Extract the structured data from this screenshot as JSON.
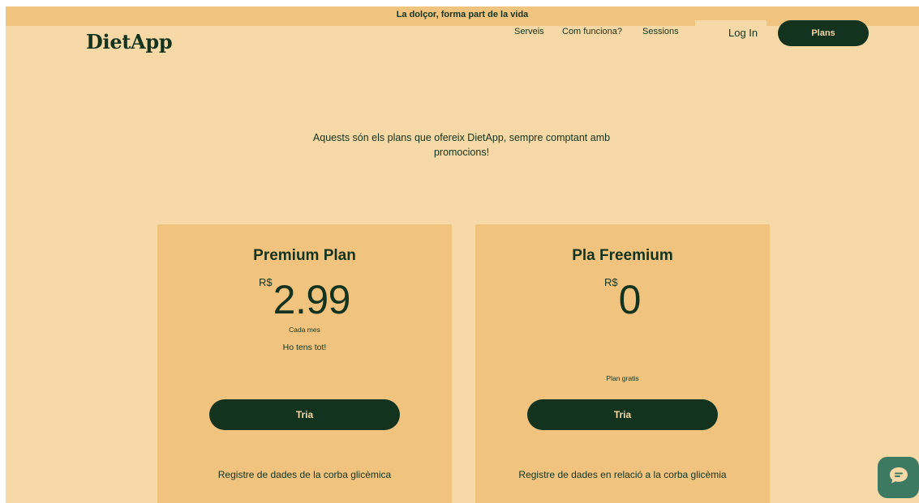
{
  "announcement": "La dolçor, forma part de la vida",
  "brand": "DietApp",
  "nav": {
    "links": [
      "Serveis",
      "Com funciona?",
      "Sessions"
    ],
    "login": "Log In",
    "plans_button": "Plans"
  },
  "intro": "Aquests són els plans que ofereix DietApp, sempre comptant amb promocions!",
  "plans": [
    {
      "title": "Premium Plan",
      "currency": "R$",
      "amount": "2.99",
      "period": "Cada mes",
      "tagline": "Ho tens tot!",
      "button": "Tria",
      "feature": "Registre de dades de la corba glicèmica"
    },
    {
      "title": "Pla Freemium",
      "currency": "R$",
      "amount": "0",
      "note": "Plan gratis",
      "button": "Tria",
      "feature": "Registre de dades en relació a la corba glicèmia"
    }
  ],
  "chat": {
    "icon": "chat-bubble-icon"
  },
  "colors": {
    "background": "#f6d9a6",
    "card": "#f0c47f",
    "dark_green": "#13331f",
    "chat_green": "#3d7a63"
  }
}
